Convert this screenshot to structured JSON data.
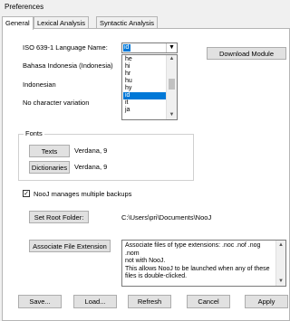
{
  "window": {
    "title": "Preferences"
  },
  "tabs": [
    {
      "label": "General",
      "active": true
    },
    {
      "label": "Lexical Analysis",
      "active": false
    },
    {
      "label": "Syntactic Analysis",
      "active": false
    }
  ],
  "language": {
    "label": "ISO 639-1 Language Name:",
    "selected": "id",
    "options": [
      "he",
      "hi",
      "hr",
      "hu",
      "hy",
      "id",
      "it",
      "ja"
    ],
    "selected_index": 5,
    "name": "Bahasa Indonesia (Indonesia)",
    "native_name": "Indonesian",
    "variation": "No character variation",
    "download_label": "Download Module"
  },
  "fonts": {
    "group_label": "Fonts",
    "texts_label": "Texts",
    "texts_value": "Verdana, 9",
    "dictionaries_label": "Dictionaries",
    "dictionaries_value": "Verdana, 9"
  },
  "backups": {
    "label": "NooJ manages multiple backups",
    "checked": true
  },
  "root_folder": {
    "button_label": "Set Root Folder:",
    "path": "C:\\Users\\pri\\Documents\\NooJ"
  },
  "file_ext": {
    "button_label": "Associate File Extension",
    "description_lines": [
      "Associate files of type extensions: .noc .nof .nog .nom",
      "not with NooJ.",
      "This allows NooJ to be launched when any of these",
      "files is double-clicked."
    ]
  },
  "footer": {
    "save": "Save...",
    "load": "Load...",
    "refresh": "Refresh",
    "cancel": "Cancel",
    "apply": "Apply"
  },
  "icons": {
    "dropdown": "chevron-down-icon",
    "scroll_up": "scroll-up-icon",
    "scroll_down": "scroll-down-icon",
    "checkmark": "checkmark-icon"
  },
  "colors": {
    "selection": "#0078d7",
    "panel": "#ffffff",
    "window": "#f0f0f0"
  }
}
